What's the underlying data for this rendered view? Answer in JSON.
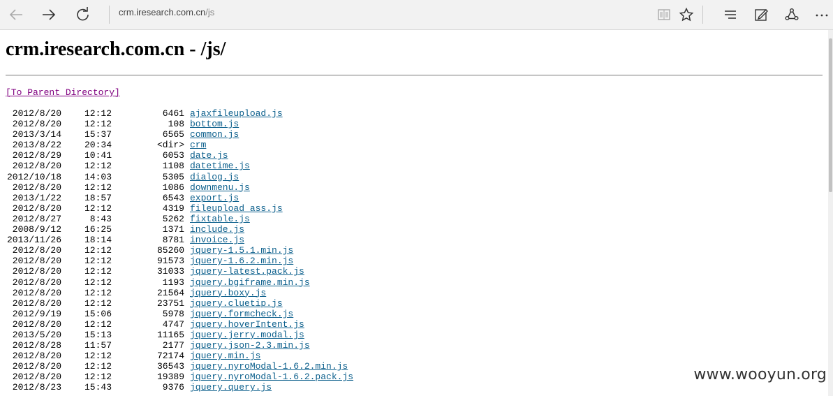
{
  "browser": {
    "address_host": "crm.iresearch.com.cn",
    "address_path": "/js"
  },
  "page": {
    "title": "crm.iresearch.com.cn - /js/",
    "parent_link": "[To Parent Directory]",
    "entries": [
      {
        "date": "2012/8/20",
        "time": "12:12",
        "size": "6461",
        "name": "ajaxfileupload.js"
      },
      {
        "date": "2012/8/20",
        "time": "12:12",
        "size": "108",
        "name": "bottom.js"
      },
      {
        "date": "2013/3/14",
        "time": "15:37",
        "size": "6565",
        "name": "common.js"
      },
      {
        "date": "2013/8/22",
        "time": "20:34",
        "size": "<dir>",
        "name": "crm"
      },
      {
        "date": "2012/8/29",
        "time": "10:41",
        "size": "6053",
        "name": "date.js"
      },
      {
        "date": "2012/8/20",
        "time": "12:12",
        "size": "1108",
        "name": "datetime.js"
      },
      {
        "date": "2012/10/18",
        "time": "14:03",
        "size": "5305",
        "name": "dialog.js"
      },
      {
        "date": "2012/8/20",
        "time": "12:12",
        "size": "1086",
        "name": "downmenu.js"
      },
      {
        "date": "2013/1/22",
        "time": "18:57",
        "size": "6543",
        "name": "export.js"
      },
      {
        "date": "2012/8/20",
        "time": "12:12",
        "size": "4319",
        "name": "fileupload ass.js"
      },
      {
        "date": "2012/8/27",
        "time": "8:43",
        "size": "5262",
        "name": "fixtable.js"
      },
      {
        "date": "2008/9/12",
        "time": "16:25",
        "size": "1371",
        "name": "include.js"
      },
      {
        "date": "2013/11/26",
        "time": "18:14",
        "size": "8781",
        "name": "invoice.js"
      },
      {
        "date": "2012/8/20",
        "time": "12:12",
        "size": "85260",
        "name": "jquery-1.5.1.min.js"
      },
      {
        "date": "2012/8/20",
        "time": "12:12",
        "size": "91573",
        "name": "jquery-1.6.2.min.js"
      },
      {
        "date": "2012/8/20",
        "time": "12:12",
        "size": "31033",
        "name": "jquery-latest.pack.js"
      },
      {
        "date": "2012/8/20",
        "time": "12:12",
        "size": "1193",
        "name": "jquery.bgiframe.min.js"
      },
      {
        "date": "2012/8/20",
        "time": "12:12",
        "size": "21564",
        "name": "jquery.boxy.js"
      },
      {
        "date": "2012/8/20",
        "time": "12:12",
        "size": "23751",
        "name": "jquery.cluetip.js"
      },
      {
        "date": "2012/9/19",
        "time": "15:06",
        "size": "5978",
        "name": "jquery.formcheck.js"
      },
      {
        "date": "2012/8/20",
        "time": "12:12",
        "size": "4747",
        "name": "jquery.hoverIntent.js"
      },
      {
        "date": "2013/5/20",
        "time": "15:13",
        "size": "11165",
        "name": "jquery.jerry.modal.js"
      },
      {
        "date": "2012/8/28",
        "time": "11:57",
        "size": "2177",
        "name": "jquery.json-2.3.min.js"
      },
      {
        "date": "2012/8/20",
        "time": "12:12",
        "size": "72174",
        "name": "jquery.min.js"
      },
      {
        "date": "2012/8/20",
        "time": "12:12",
        "size": "36543",
        "name": "jquery.nyroModal-1.6.2.min.js"
      },
      {
        "date": "2012/8/20",
        "time": "12:12",
        "size": "19389",
        "name": "jquery.nyroModal-1.6.2.pack.js"
      },
      {
        "date": "2012/8/23",
        "time": "15:43",
        "size": "9376",
        "name": "jquery.query.js"
      }
    ]
  },
  "watermark": "www.wooyun.org"
}
